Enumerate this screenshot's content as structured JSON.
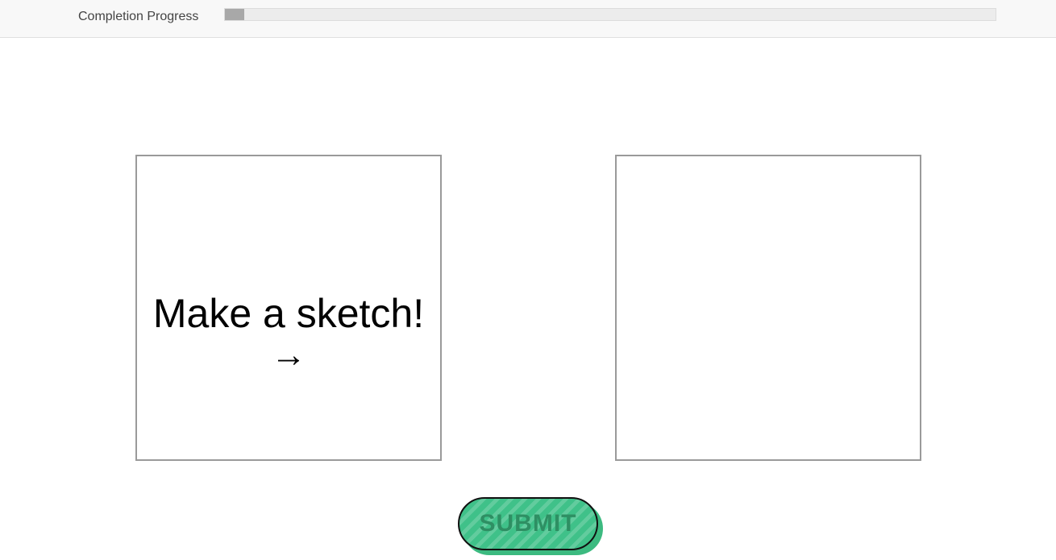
{
  "header": {
    "progress_label": "Completion Progress",
    "progress_fraction": 0.025
  },
  "sketch_panel": {
    "prompt": "Make a sketch!",
    "arrow": "→"
  },
  "result_panel": {},
  "submit": {
    "label": "SUBMIT",
    "color": "#3fc189"
  }
}
